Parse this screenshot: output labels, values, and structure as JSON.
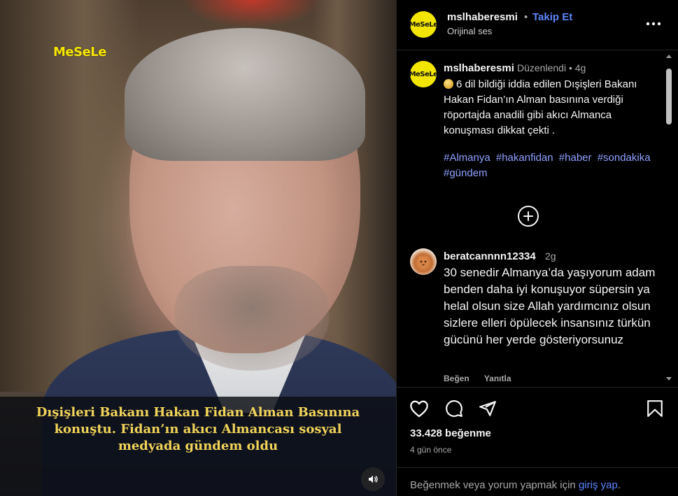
{
  "video": {
    "logo": "MeSeLe",
    "caption": "Dışişleri Bakanı Hakan Fidan Alman Basınına konuştu. Fidan’ın akıcı Almancası sosyal medyada gündem oldu"
  },
  "header": {
    "avatar_text": "MeSeLe",
    "username": "mslhaberesmi",
    "separator": "•",
    "follow_label": "Takip Et",
    "audio": "Orijinal ses"
  },
  "post": {
    "username": "mslhaberesmi",
    "meta": "Düzenlendi  •  4g",
    "caption": "6 dil bildiği iddia edilen Dışişleri Bakanı Hakan Fidan’ın Alman basınına verdiği röportajda anadili gibi akıcı Almanca konuşması dikkat çekti .",
    "hashtags": [
      "#Almanya",
      "#hakanfidan",
      "#haber",
      "#sondakika",
      "#gündem"
    ]
  },
  "comment": {
    "username": "beratcannnn12334",
    "time": "2g",
    "text": "30 senedir Almanya’da yaşıyorum adam benden daha iyi konuşuyor süpersin ya helal olsun size Allah yardımcınız olsun sizlere elleri öpülecek insansınız türkün gücünü her yerde gösteriyorsunuz",
    "like_label": "Beğen",
    "reply_label": "Yanıtla"
  },
  "stats": {
    "likes": "33.428 beğenme",
    "date": "4 gün önce"
  },
  "footer": {
    "text": "Beğenmek veya yorum yapmak için",
    "link": "giriş yap",
    "end": "."
  },
  "icons": {
    "like": "heart-icon",
    "comment": "comment-icon",
    "share": "share-icon",
    "save": "bookmark-icon",
    "more": "more-icon",
    "load_more": "plus-circle-icon",
    "sound": "speaker-icon"
  },
  "colors": {
    "accent": "#5e86ff",
    "caption": "#f2d45a",
    "brand_yellow": "#f2e600"
  }
}
